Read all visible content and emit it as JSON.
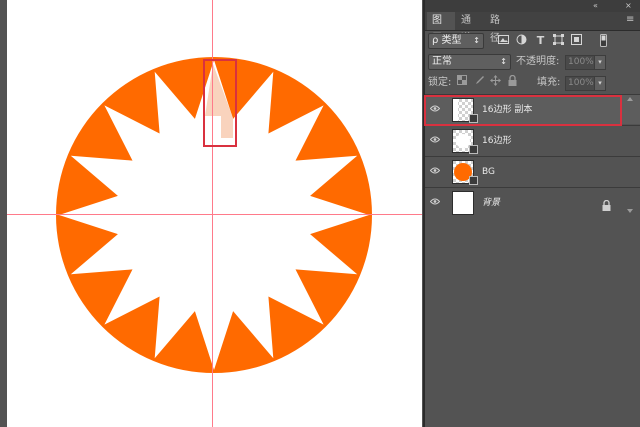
{
  "canvas": {
    "shape_color": "#ff6a00",
    "selection_fill_color": "#f9d3bd",
    "selection_box_color": "#d9313f",
    "guide_color": "#ff7a8a",
    "star_points": 16
  },
  "panel_topbar": {
    "collapse_glyph": "«",
    "close_glyph": "×",
    "menu_glyph": "≡"
  },
  "tabs": [
    {
      "label": "图层",
      "active": true
    },
    {
      "label": "通道",
      "active": false
    },
    {
      "label": "路径",
      "active": false
    }
  ],
  "filter": {
    "kind_label": "ρ 类型",
    "stepper_glyph": "↕"
  },
  "blend": {
    "mode_label": "正常",
    "opacity_label": "不透明度:",
    "opacity_value": "100%"
  },
  "lock": {
    "label": "锁定:",
    "fill_label": "填充:",
    "fill_value": "100%"
  },
  "layers": [
    {
      "name": "16边形 副本",
      "selected": true,
      "thumb": "star-copy",
      "locked": false,
      "italic": false
    },
    {
      "name": "16边形",
      "selected": false,
      "thumb": "star",
      "locked": false,
      "italic": false
    },
    {
      "name": "BG",
      "selected": false,
      "thumb": "bg-circle",
      "locked": false,
      "italic": false
    },
    {
      "name": "背景",
      "selected": false,
      "thumb": "white",
      "locked": true,
      "italic": true
    }
  ]
}
